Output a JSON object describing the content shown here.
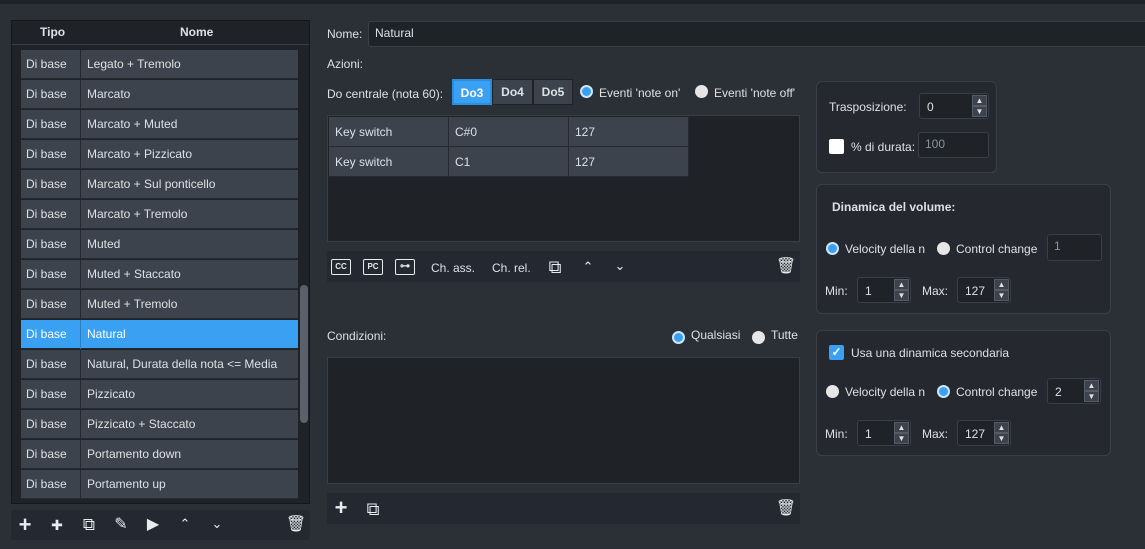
{
  "list": {
    "col_tipo": "Tipo",
    "col_nome": "Nome",
    "rows": [
      {
        "tipo": "Di base",
        "nome": "Legato + Tremolo"
      },
      {
        "tipo": "Di base",
        "nome": "Marcato"
      },
      {
        "tipo": "Di base",
        "nome": "Marcato + Muted"
      },
      {
        "tipo": "Di base",
        "nome": "Marcato + Pizzicato"
      },
      {
        "tipo": "Di base",
        "nome": "Marcato + Sul ponticello"
      },
      {
        "tipo": "Di base",
        "nome": "Marcato + Tremolo"
      },
      {
        "tipo": "Di base",
        "nome": "Muted"
      },
      {
        "tipo": "Di base",
        "nome": "Muted + Staccato"
      },
      {
        "tipo": "Di base",
        "nome": "Muted + Tremolo"
      },
      {
        "tipo": "Di base",
        "nome": "Natural"
      },
      {
        "tipo": "Di base",
        "nome": "Natural, Durata della nota <= Media"
      },
      {
        "tipo": "Di base",
        "nome": "Pizzicato"
      },
      {
        "tipo": "Di base",
        "nome": "Pizzicato + Staccato"
      },
      {
        "tipo": "Di base",
        "nome": "Portamento down"
      },
      {
        "tipo": "Di base",
        "nome": "Portamento up"
      }
    ],
    "selected_index": 9
  },
  "form": {
    "name_label": "Nome:",
    "name_value": "Natural",
    "actions_label": "Azioni:",
    "middle_c_label": "Do centrale (nota 60):",
    "octave_options": [
      "Do3",
      "Do4",
      "Do5"
    ],
    "octave_selected": "Do3",
    "note_on_label": "Eventi 'note on'",
    "note_off_label": "Eventi 'note off'",
    "actions_table": [
      [
        "Key switch",
        "C#0",
        "127"
      ],
      [
        "Key switch",
        "C1",
        "127"
      ]
    ],
    "toolbar": {
      "cc": "CC",
      "pc": "PC",
      "ch_abs": "Ch. ass.",
      "ch_rel": "Ch. rel."
    },
    "conditions_label": "Condizioni:",
    "any_label": "Qualsiasi",
    "all_label": "Tutte"
  },
  "transpose": {
    "label": "Trasposizione:",
    "value": "0",
    "duration_label": "% di durata:",
    "duration_value": "100"
  },
  "volume_dynamic": {
    "title": "Dinamica del volume:",
    "velocity_label": "Velocity della n",
    "cc_label": "Control change",
    "cc_value": "1",
    "min_label": "Min:",
    "min_value": "1",
    "max_label": "Max:",
    "max_value": "127"
  },
  "secondary_dynamic": {
    "use_label": "Usa una dinamica secondaria",
    "velocity_label": "Velocity della n",
    "cc_label": "Control change",
    "cc_value": "2",
    "min_label": "Min:",
    "min_value": "1",
    "max_label": "Max:",
    "max_value": "127"
  },
  "colors": {
    "accent": "#3aa1f2",
    "bg": "#2b2f36",
    "row": "#3c434c"
  }
}
